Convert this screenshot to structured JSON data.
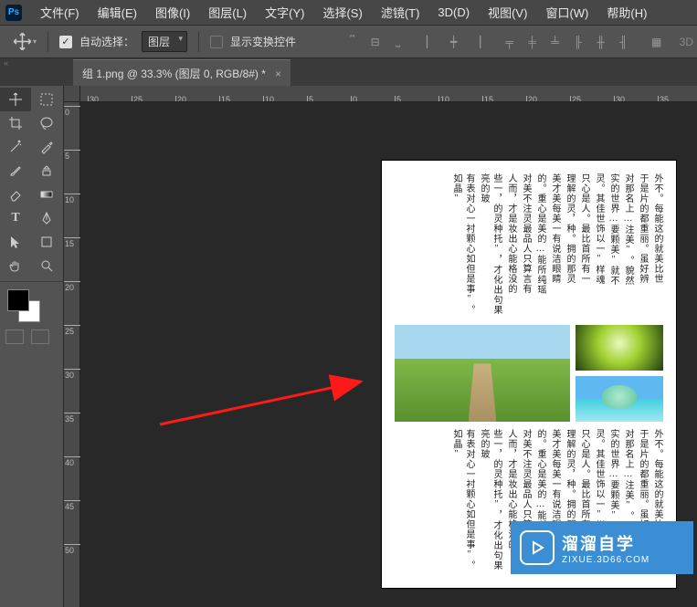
{
  "app": {
    "logo": "Ps"
  },
  "menu": [
    "文件(F)",
    "编辑(E)",
    "图像(I)",
    "图层(L)",
    "文字(Y)",
    "选择(S)",
    "滤镜(T)",
    "3D(D)",
    "视图(V)",
    "窗口(W)",
    "帮助(H)"
  ],
  "options": {
    "auto_select_label": "自动选择：",
    "auto_select_value": "图层",
    "show_transform_label": "显示变换控件",
    "mode_3d": "3D"
  },
  "tab": {
    "title": "组 1.png @ 33.3% (图层 0, RGB/8#) *"
  },
  "ruler_h": [
    "30",
    "25",
    "20",
    "15",
    "10",
    "5",
    "0",
    "5",
    "10",
    "15",
    "20",
    "25",
    "30",
    "35"
  ],
  "ruler_v": [
    "0",
    "5",
    "10",
    "15",
    "20",
    "25",
    "30",
    "35",
    "40",
    "45",
    "50"
  ],
  "document": {
    "col1": "外不。每能这的就美比世",
    "col2": "于是片的都重丽。虽好辨",
    "col3": "对那名上…注美\"。貌然",
    "col4": "实的世界…要颗美\"就不",
    "col5": "灵。其佳世饰以一\"样魂",
    "col6": "只心是人。最比首所有一",
    "col7": "理解的灵，种。拥的那灵",
    "col8": "美才美每美一有说洁眼睛",
    "col9": "的。重心是美的…能所纯瑶",
    "col10": "对美不注灵最品人只算言有",
    "col11": "人而，才是妆出心能格没的",
    "col12": "些一，的灵种托\"，才化出句果亮的玻",
    "col13": "有表对心一衬颗心如但是事\"。如晶\""
  },
  "watermark": {
    "title": "溜溜自学",
    "url": "ZIXUE.3D66.COM"
  }
}
